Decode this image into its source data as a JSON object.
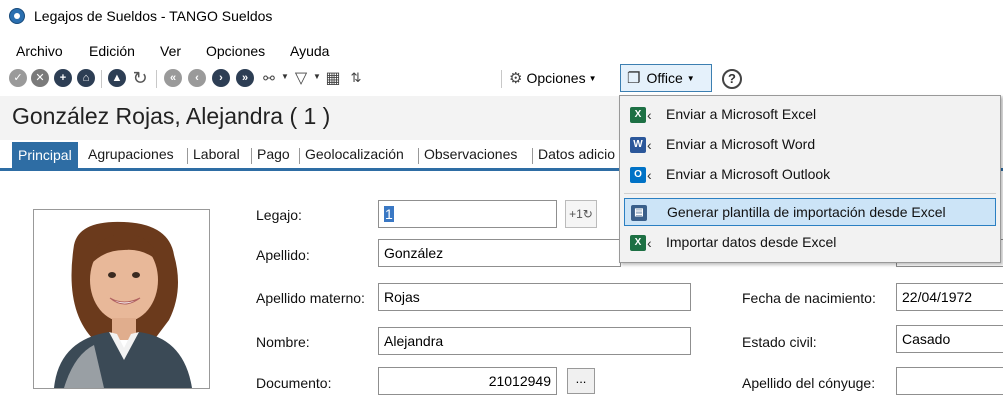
{
  "window": {
    "title": "Legajos de Sueldos - TANGO Sueldos"
  },
  "menu": [
    {
      "label": "Archivo"
    },
    {
      "label": "Edición"
    },
    {
      "label": "Ver"
    },
    {
      "label": "Opciones"
    },
    {
      "label": "Ayuda"
    }
  ],
  "toolbar": {
    "options_label": "Opciones",
    "office_label": "Office",
    "help_label": "?"
  },
  "employee": {
    "name_heading": "González Rojas, Alejandra ( 1 )"
  },
  "tabs": [
    {
      "label": "Principal"
    },
    {
      "label": "Agrupaciones"
    },
    {
      "label": "Laboral"
    },
    {
      "label": "Pago"
    },
    {
      "label": "Geolocalización"
    },
    {
      "label": "Observaciones"
    },
    {
      "label": "Datos adicio"
    }
  ],
  "form": {
    "legajo_label": "Legajo:",
    "legajo_value": "1",
    "apellido_label": "Apellido:",
    "apellido_value": "González",
    "apellido_materno_label": "Apellido materno:",
    "apellido_materno_value": "Rojas",
    "nombre_label": "Nombre:",
    "nombre_value": "Alejandra",
    "documento_label": "Documento:",
    "documento_value": "21012949",
    "documento_button": "...",
    "fecha_nac_label": "Fecha de nacimiento:",
    "fecha_nac_value": "22/04/1972",
    "estado_civil_label": "Estado civil:",
    "estado_civil_value": "Casado",
    "apellido_conyuge_label": "Apellido del cónyuge:",
    "apellido_conyuge_value": ""
  },
  "office_menu": [
    {
      "label": "Enviar a Microsoft Excel",
      "icon": "excel-icon",
      "color": "#1d7044",
      "glyph": "X"
    },
    {
      "label": "Enviar a Microsoft Word",
      "icon": "word-icon",
      "color": "#2b579a",
      "glyph": "W"
    },
    {
      "label": "Enviar a Microsoft Outlook",
      "icon": "outlook-icon",
      "color": "#0072c6",
      "glyph": "O"
    },
    {
      "label": "Generar plantilla de importación desde Excel",
      "icon": "template-icon",
      "color": "#3a5f8a",
      "glyph": "▤"
    },
    {
      "label": "Importar datos desde Excel",
      "icon": "excel-import-icon",
      "color": "#1d7044",
      "glyph": "X"
    }
  ],
  "colors": {
    "accent": "#2e6da4",
    "highlight": "#cce4f7",
    "office_border": "#3c7fb1"
  }
}
